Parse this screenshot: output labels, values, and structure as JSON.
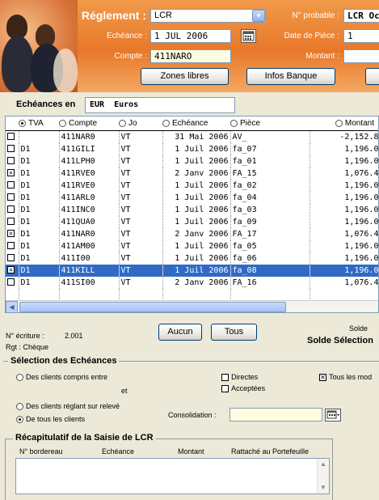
{
  "header": {
    "title": "Réglement :",
    "reglement_value": "LCR",
    "echeance_label": "Echéance :",
    "echeance_value": "1 JUL 2006",
    "compte_label": "Compte :",
    "compte_value": "411NARO",
    "no_probable_label": "N° probable :",
    "no_probable_value": "LCR Oc",
    "date_piece_label": "Date de Pièce :",
    "date_piece_value": "1",
    "montant_label": "Montant :",
    "montant_value": "",
    "zones_libres": "Zones libres",
    "infos_banque": "Infos Banque"
  },
  "echeances": {
    "label": "Echéances en",
    "currency": "EUR  Euros"
  },
  "grid": {
    "columns": [
      "TVA",
      "Compte",
      "Jo",
      "Echéance",
      "Pièce",
      "Montant"
    ],
    "rows": [
      {
        "checked": false,
        "tva": "",
        "compte": "411NAR0",
        "jo": "VT",
        "echeance": "31 Mai 2006",
        "piece": "AV_",
        "montant": "-2,152.80",
        "selected": false
      },
      {
        "checked": false,
        "tva": "D1",
        "compte": "411GILI",
        "jo": "VT",
        "echeance": "1 Juil 2006",
        "piece": "fa_07",
        "montant": "1,196.00",
        "selected": false
      },
      {
        "checked": false,
        "tva": "D1",
        "compte": "411LPH0",
        "jo": "VT",
        "echeance": "1 Juil 2006",
        "piece": "fa_01",
        "montant": "1,196.00",
        "selected": false
      },
      {
        "checked": true,
        "tva": "D1",
        "compte": "411RVE0",
        "jo": "VT",
        "echeance": "2 Janv 2006",
        "piece": "FA_15",
        "montant": "1,076.40",
        "selected": false
      },
      {
        "checked": false,
        "tva": "D1",
        "compte": "411RVE0",
        "jo": "VT",
        "echeance": "1 Juil 2006",
        "piece": "fa_02",
        "montant": "1,196.00",
        "selected": false
      },
      {
        "checked": false,
        "tva": "D1",
        "compte": "411ARL0",
        "jo": "VT",
        "echeance": "1 Juil 2006",
        "piece": "fa_04",
        "montant": "1,196.00",
        "selected": false
      },
      {
        "checked": false,
        "tva": "D1",
        "compte": "411INC0",
        "jo": "VT",
        "echeance": "1 Juil 2006",
        "piece": "fa_03",
        "montant": "1,196.00",
        "selected": false
      },
      {
        "checked": false,
        "tva": "D1",
        "compte": "411QUA0",
        "jo": "VT",
        "echeance": "1 Juil 2006",
        "piece": "fa_09",
        "montant": "1,196.00",
        "selected": false
      },
      {
        "checked": true,
        "tva": "D1",
        "compte": "411NAR0",
        "jo": "VT",
        "echeance": "2 Janv 2006",
        "piece": "FA_17",
        "montant": "1,076.40",
        "selected": false
      },
      {
        "checked": false,
        "tva": "D1",
        "compte": "411AM00",
        "jo": "VT",
        "echeance": "1 Juil 2006",
        "piece": "fa_05",
        "montant": "1,196.00",
        "selected": false
      },
      {
        "checked": false,
        "tva": "D1",
        "compte": "411I00",
        "jo": "VT",
        "echeance": "1 Juil 2006",
        "piece": "fa_06",
        "montant": "1,196.00",
        "selected": false
      },
      {
        "checked": true,
        "tva": "D1",
        "compte": "411KILL",
        "jo": "VT",
        "echeance": "1 Juil 2006",
        "piece": "fa_08",
        "montant": "1,196.00",
        "selected": true
      },
      {
        "checked": false,
        "tva": "D1",
        "compte": "411SI00",
        "jo": "VT",
        "echeance": "2 Janv 2006",
        "piece": "FA_16",
        "montant": "1,076.40",
        "selected": false
      }
    ]
  },
  "footer": {
    "no_ecriture_label": "N° écriture :",
    "no_ecriture_value": "2.001",
    "rgt": "Rgt : Chèque",
    "aucun": "Aucun",
    "tous": "Tous",
    "solde": "Solde",
    "solde_selection": "Solde Sélection"
  },
  "selection": {
    "title": "Sélection des Echéances",
    "opt1": "Des clients compris entre",
    "et": "et",
    "opt2": "Des clients réglant sur relevé",
    "opt3": "De tous les clients",
    "directes": "Directes",
    "acceptees": "Acceptées",
    "tous_modes": "Tous les mod",
    "consolidation": "Consolidation :"
  },
  "recap": {
    "title": "Récapitulatif de la Saisie de LCR",
    "columns": [
      "N° bordereau",
      "Echéance",
      "Montant",
      "Rattaché au Portefeuille"
    ]
  },
  "colors": {
    "header": "#e8782a",
    "selection": "#316ac5"
  }
}
